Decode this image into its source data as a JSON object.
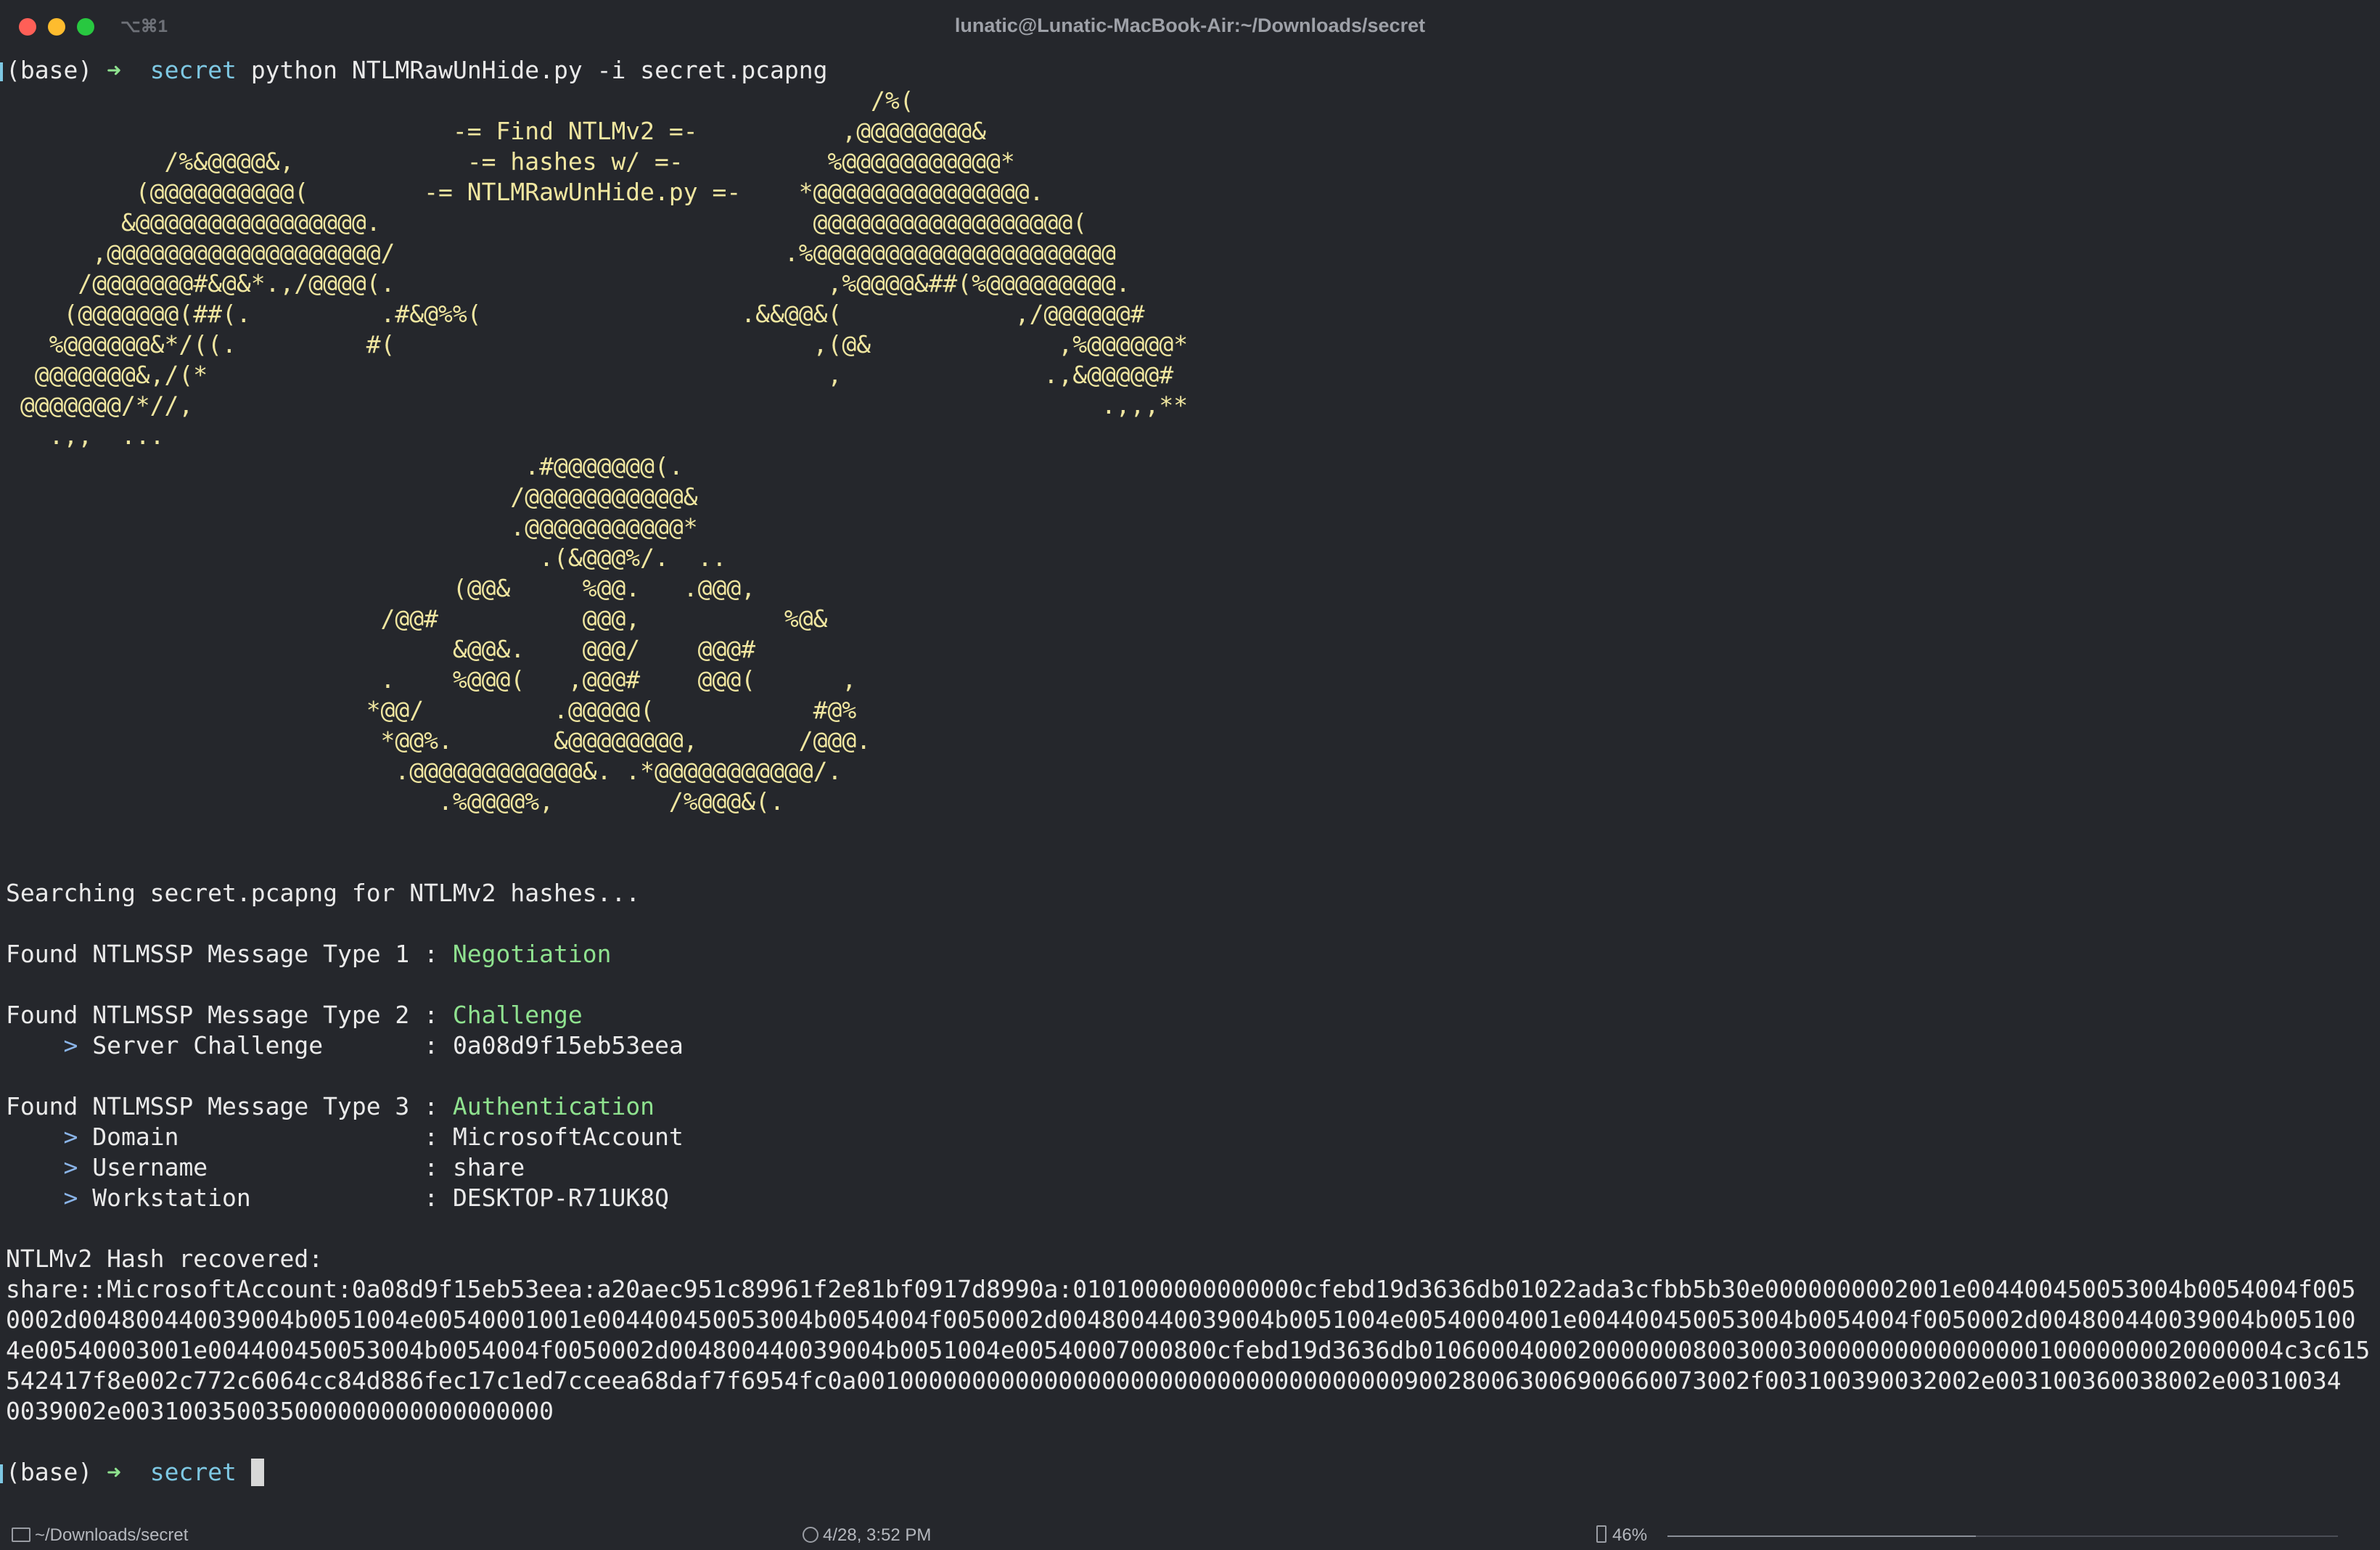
{
  "window": {
    "title": "lunatic@Lunatic-MacBook-Air:~/Downloads/secret",
    "shortcut": "⌥⌘1"
  },
  "prompt1": {
    "env": "(base)",
    "arrow": "➜",
    "dir": "secret",
    "command": "python NTLMRawUnHide.py -i secret.pcapng"
  },
  "banner": {
    "lines": [
      "                                                            /%(",
      "                               -= Find NTLMv2 =-          ,@@@@@@@@&",
      "           /%&@@@@&,            -= hashes w/ =-          %@@@@@@@@@@@*",
      "         (@@@@@@@@@@(        -= NTLMRawUnHide.py =-    *@@@@@@@@@@@@@@@.",
      "        &@@@@@@@@@@@@@@@@.                              @@@@@@@@@@@@@@@@@@(",
      "      ,@@@@@@@@@@@@@@@@@@@/                           .%@@@@@@@@@@@@@@@@@@@@@",
      "     /@@@@@@@#&@&*.,/@@@@(.                              ,%@@@@&##(%@@@@@@@@@.",
      "    (@@@@@@@(##(.         .#&@%%(                  .&&@@&(            ,/@@@@@@#",
      "   %@@@@@@&*/((.         #(                             ,(@&             ,%@@@@@@*",
      "  @@@@@@@&,/(*                                           ,              .,&@@@@@#",
      " @@@@@@@/*//,                                                               .,,,**",
      "   .,,  ...",
      "                                    .#@@@@@@@(.",
      "                                   /@@@@@@@@@@@&",
      "                                   .@@@@@@@@@@@*",
      "                                     .(&@@@%/.  ..",
      "                               (@@&     %@@.   .@@@,",
      "                          /@@#          @@@,          %@&",
      "                               &@@&.    @@@/    @@@#",
      "                          .    %@@@(   ,@@@#    @@@(      ,",
      "                         *@@/         .@@@@@(           #@%",
      "                          *@@%.       &@@@@@@@@,       /@@@.",
      "                           .@@@@@@@@@@@@&. .*@@@@@@@@@@@/.",
      "                              .%@@@@%,        /%@@@&(."
    ]
  },
  "output": {
    "searching": "Searching secret.pcapng for NTLMv2 hashes...",
    "type1": {
      "label": "Found NTLMSSP Message Type 1 : ",
      "value": "Negotiation"
    },
    "type2": {
      "label": "Found NTLMSSP Message Type 2 : ",
      "value": "Challenge"
    },
    "server_challenge": {
      "label": "Server Challenge       : ",
      "value": "0a08d9f15eb53eea"
    },
    "type3": {
      "label": "Found NTLMSSP Message Type 3 : ",
      "value": "Authentication"
    },
    "domain": {
      "label": "Domain                 : ",
      "value": "MicrosoftAccount"
    },
    "username": {
      "label": "Username               : ",
      "value": "share"
    },
    "workstation": {
      "label": "Workstation            : ",
      "value": "DESKTOP-R71UK8Q"
    },
    "hash_header": "NTLMv2 Hash recovered:",
    "hash_lines": [
      "share::MicrosoftAccount:0a08d9f15eb53eea:a20aec951c89961f2e81bf0917d8990a:0101000000000000cfebd19d3636db01022ada3cfbb5b30e0000000002001e004400450053004b0054004f005",
      "0002d004800440039004b0051004e00540001001e004400450053004b0054004f0050002d004800440039004b0051004e00540004001e004400450053004b0054004f0050002d004800440039004b005100",
      "4e00540003001e004400450053004b0054004f0050002d004800440039004b0051004e00540007000800cfebd19d3636db010600040002000000080030003000000000000000010000000020000004c3c615",
      "542417f8e002c772c6064cc84d886fec17c1ed7cceea68daf7f6954fc0a00100000000000000000000000000000000000900280063006900660073002f003100390032002e003100360038002e00310034",
      "0039002e003100350035000000000000000000"
    ]
  },
  "prompt2": {
    "env": "(base)",
    "arrow": "➜",
    "dir": "secret"
  },
  "statusbar": {
    "path": "~/Downloads/secret",
    "datetime": "4/28, 3:52 PM",
    "battery": "46%",
    "battery_level": 0.46
  }
}
